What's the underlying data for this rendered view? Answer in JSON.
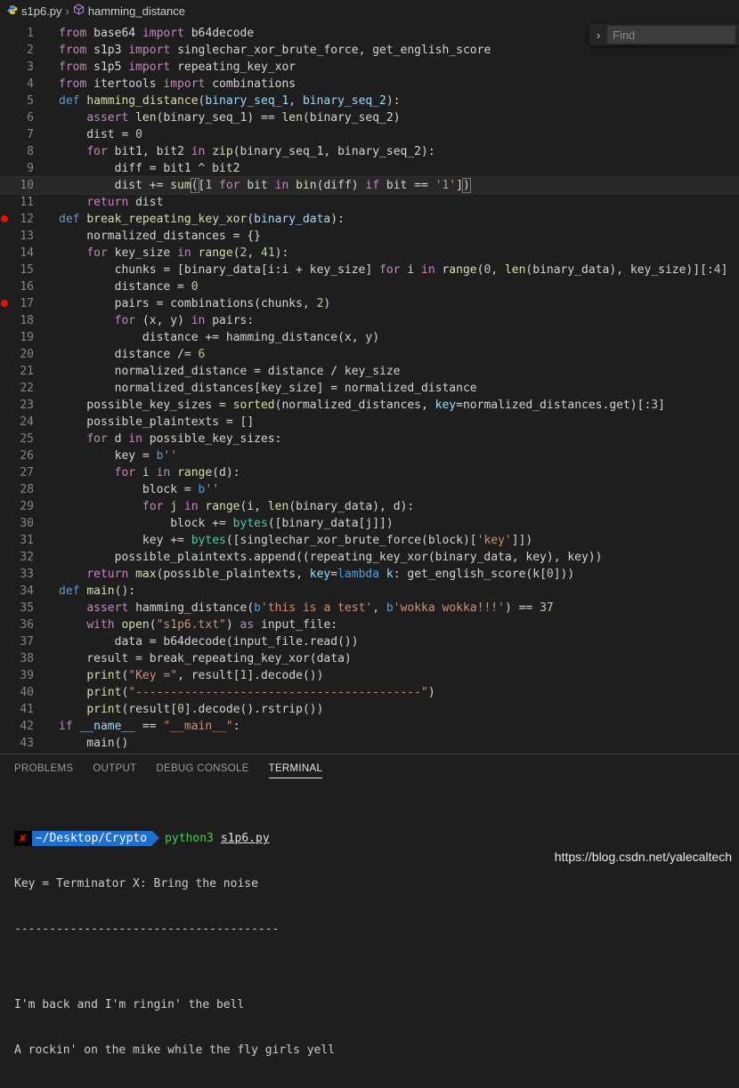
{
  "breadcrumb": {
    "file": "s1p6.py",
    "symbol": "hamming_distance"
  },
  "find": {
    "placeholder": "Find"
  },
  "code_lines": [
    {
      "n": "1",
      "bp": false,
      "html": "<span class='c'>from</span> base64 <span class='c'>import</span> b64decode"
    },
    {
      "n": "2",
      "bp": false,
      "html": "<span class='c'>from</span> s1p3 <span class='c'>import</span> singlechar_xor_brute_force, get_english_score"
    },
    {
      "n": "3",
      "bp": false,
      "html": "<span class='c'>from</span> s1p5 <span class='c'>import</span> repeating_key_xor"
    },
    {
      "n": "4",
      "bp": false,
      "html": "<span class='c'>from</span> itertools <span class='c'>import</span> combinations"
    },
    {
      "n": "5",
      "bp": false,
      "html": "<span class='k'>def</span> <span class='f'>hamming_distance</span>(<span class='v'>binary_seq_1</span>, <span class='v'>binary_seq_2</span>):"
    },
    {
      "n": "6",
      "bp": false,
      "html": "    <span class='c'>assert</span> <span class='f'>len</span>(binary_seq_1) == <span class='f'>len</span>(binary_seq_2)"
    },
    {
      "n": "7",
      "bp": false,
      "html": "    dist = <span class='n'>0</span>"
    },
    {
      "n": "8",
      "bp": false,
      "html": "    <span class='c'>for</span> bit1, bit2 <span class='c'>in</span> <span class='f'>zip</span>(binary_seq_1, binary_seq_2):"
    },
    {
      "n": "9",
      "bp": false,
      "html": "        diff = bit1 ^ bit2"
    },
    {
      "n": "10",
      "bp": false,
      "active": true,
      "html": "        dist += <span class='f'>sum</span><span class='brk'>(</span>[<span class='n'>1</span> <span class='c'>for</span> bit <span class='c'>in</span> <span class='f'>bin</span>(diff) <span class='c'>if</span> bit == <span class='s'>'1'</span>]<span class='brk'>)</span><span class='cursor'></span>"
    },
    {
      "n": "11",
      "bp": false,
      "html": "    <span class='c'>return</span> dist"
    },
    {
      "n": "12",
      "bp": true,
      "html": "<span class='k'>def</span> <span class='f'>break_repeating_key_xor</span>(<span class='v'>binary_data</span>):"
    },
    {
      "n": "13",
      "bp": false,
      "html": "    normalized_distances = {}"
    },
    {
      "n": "14",
      "bp": false,
      "html": "    <span class='c'>for</span> key_size <span class='c'>in</span> <span class='f'>range</span>(<span class='n'>2</span>, <span class='n'>41</span>):"
    },
    {
      "n": "15",
      "bp": false,
      "html": "        chunks = [binary_data[i:i + key_size] <span class='c'>for</span> i <span class='c'>in</span> <span class='f'>range</span>(<span class='n'>0</span>, <span class='f'>len</span>(binary_data), key_size)][:<span class='n'>4</span>]"
    },
    {
      "n": "16",
      "bp": false,
      "html": "        distance = <span class='n'>0</span>"
    },
    {
      "n": "17",
      "bp": true,
      "html": "        pairs = combinations(chunks, <span class='n'>2</span>)"
    },
    {
      "n": "18",
      "bp": false,
      "html": "        <span class='c'>for</span> (x, y) <span class='c'>in</span> pairs:"
    },
    {
      "n": "19",
      "bp": false,
      "html": "            distance += hamming_distance(x, y)"
    },
    {
      "n": "20",
      "bp": false,
      "html": "        distance /= <span class='n'>6</span>"
    },
    {
      "n": "21",
      "bp": false,
      "html": "        normalized_distance = distance / key_size"
    },
    {
      "n": "22",
      "bp": false,
      "html": "        normalized_distances[key_size] = normalized_distance"
    },
    {
      "n": "23",
      "bp": false,
      "html": "    possible_key_sizes = <span class='f'>sorted</span>(normalized_distances, <span class='v'>key</span>=normalized_distances.get)[:<span class='n'>3</span>]"
    },
    {
      "n": "24",
      "bp": false,
      "html": "    possible_plaintexts = []"
    },
    {
      "n": "25",
      "bp": false,
      "html": "    <span class='c'>for</span> d <span class='c'>in</span> possible_key_sizes:"
    },
    {
      "n": "26",
      "bp": false,
      "html": "        key = <span class='k'>b</span><span class='s'>''</span>"
    },
    {
      "n": "27",
      "bp": false,
      "html": "        <span class='c'>for</span> i <span class='c'>in</span> <span class='f'>range</span>(d):"
    },
    {
      "n": "28",
      "bp": false,
      "html": "            block = <span class='k'>b</span><span class='s'>''</span>"
    },
    {
      "n": "29",
      "bp": false,
      "html": "            <span class='c'>for</span> j <span class='c'>in</span> <span class='f'>range</span>(i, <span class='f'>len</span>(binary_data), d):"
    },
    {
      "n": "30",
      "bp": false,
      "html": "                block += <span class='t'>bytes</span>([binary_data[j]])"
    },
    {
      "n": "31",
      "bp": false,
      "html": "            key += <span class='t'>bytes</span>([singlechar_xor_brute_force(block)[<span class='s'>'key'</span>]])"
    },
    {
      "n": "32",
      "bp": false,
      "html": "        possible_plaintexts.append((repeating_key_xor(binary_data, key), key))"
    },
    {
      "n": "33",
      "bp": false,
      "html": "    <span class='c'>return</span> <span class='f'>max</span>(possible_plaintexts, <span class='v'>key</span>=<span class='k'>lambda</span> <span class='v'>k</span>: get_english_score(k[<span class='n'>0</span>]))"
    },
    {
      "n": "34",
      "bp": false,
      "html": "<span class='k'>def</span> <span class='f'>main</span>():"
    },
    {
      "n": "35",
      "bp": false,
      "html": "    <span class='c'>assert</span> hamming_distance(<span class='k'>b</span><span class='s'>'this is a test'</span>, <span class='k'>b</span><span class='s'>'wokka wokka!!!'</span>) == <span class='n'>37</span>"
    },
    {
      "n": "36",
      "bp": false,
      "html": "    <span class='c'>with</span> <span class='f'>open</span>(<span class='s'>\"s1p6.txt\"</span>) <span class='c'>as</span> input_file:"
    },
    {
      "n": "37",
      "bp": false,
      "html": "        data = b64decode(input_file.read())"
    },
    {
      "n": "38",
      "bp": false,
      "html": "    result = break_repeating_key_xor(data)"
    },
    {
      "n": "39",
      "bp": false,
      "html": "    <span class='f'>print</span>(<span class='s'>\"Key =\"</span>, result[<span class='n'>1</span>].decode())"
    },
    {
      "n": "40",
      "bp": false,
      "html": "    <span class='f'>print</span>(<span class='s'>\"-----------------------------------------\"</span>)"
    },
    {
      "n": "41",
      "bp": false,
      "html": "    <span class='f'>print</span>(result[<span class='n'>0</span>].decode().rstrip())"
    },
    {
      "n": "42",
      "bp": false,
      "html": "<span class='c'>if</span> <span class='v'>__name__</span> == <span class='s'>\"__main__\"</span>:"
    },
    {
      "n": "43",
      "bp": false,
      "html": "    main()"
    }
  ],
  "panel": {
    "tabs": [
      "PROBLEMS",
      "OUTPUT",
      "DEBUG CONSOLE",
      "TERMINAL"
    ],
    "active_tab": "TERMINAL"
  },
  "terminal": {
    "prompt_x": "✘",
    "prompt_dir": "~/Desktop/Crypto",
    "command": "python3",
    "arg": "s1p6.py",
    "output": [
      "Key = Terminator X: Bring the noise",
      "--------------------------------------",
      "",
      "I'm back and I'm ringin' the bell",
      "A rockin' on the mike while the fly girls yell"
    ]
  },
  "watermark": "https://blog.csdn.net/yalecaltech"
}
